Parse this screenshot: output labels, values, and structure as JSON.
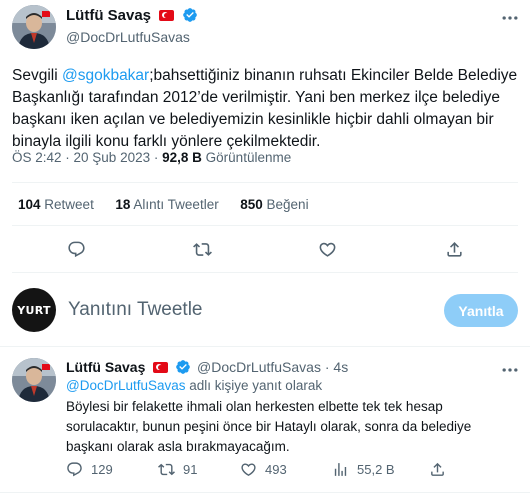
{
  "main_tweet": {
    "author_name": "Lütfü Savaş",
    "handle": "@DocDrLutfuSavas",
    "text_prefix": "Sevgili ",
    "mention": "@sgokbakar",
    "text_line1_rest": ";bahsettiğiniz binanın ruhsatı Ekinciler Belde Belediye",
    "text_line2": "Başkanlığı tarafından 2012’de verilmiştir. Yani ben merkez ilçe belediye",
    "text_line3": "başkanı iken açılan ve belediyemizin kesinlikle hiçbir dahli olmayan bir",
    "text_line4": "binayla ilgili konu farklı yönlere çekilmektedir.",
    "timestamp": "ÖS 2:42 · 20 Şub 2023 ·",
    "views_count": "92,8 B",
    "views_label": "Görüntülenme",
    "stats": {
      "retweets": "104",
      "retweets_label": "Retweet",
      "quotes": "18",
      "quotes_label": "Alıntı Tweetler",
      "likes": "850",
      "likes_label": "Beğeni"
    }
  },
  "reply_composer": {
    "avatar_text": "YURT",
    "placeholder": "Yanıtını Tweetle",
    "button_label": "Yanıtla"
  },
  "reply_tweet": {
    "author_name": "Lütfü Savaş",
    "handle_time": "@DocDrLutfuSavas · 4s",
    "reply_to_handle": "@DocDrLutfuSavas",
    "reply_to_suffix": " adlı kişiye yanıt olarak",
    "line1": "Böylesi bir felakette ihmali olan herkesten elbette tek tek hesap",
    "line2": "sorulacaktır, bunun peşini önce bir  Hataylı olarak, sonra da belediye",
    "line3": "başkanı olarak  asla bırakmayacağım.",
    "counts": {
      "replies": "129",
      "retweets": "91",
      "likes": "493",
      "views": "55,2 B"
    }
  },
  "colors": {
    "accent": "#1d9bf0",
    "button_disabled": "#8ecdf8",
    "muted": "#536471",
    "divider": "#eff3f4"
  },
  "icons": [
    "more-icon",
    "verified-icon",
    "flag-icon",
    "reply-icon",
    "retweet-icon",
    "like-icon",
    "share-icon",
    "views-icon"
  ]
}
